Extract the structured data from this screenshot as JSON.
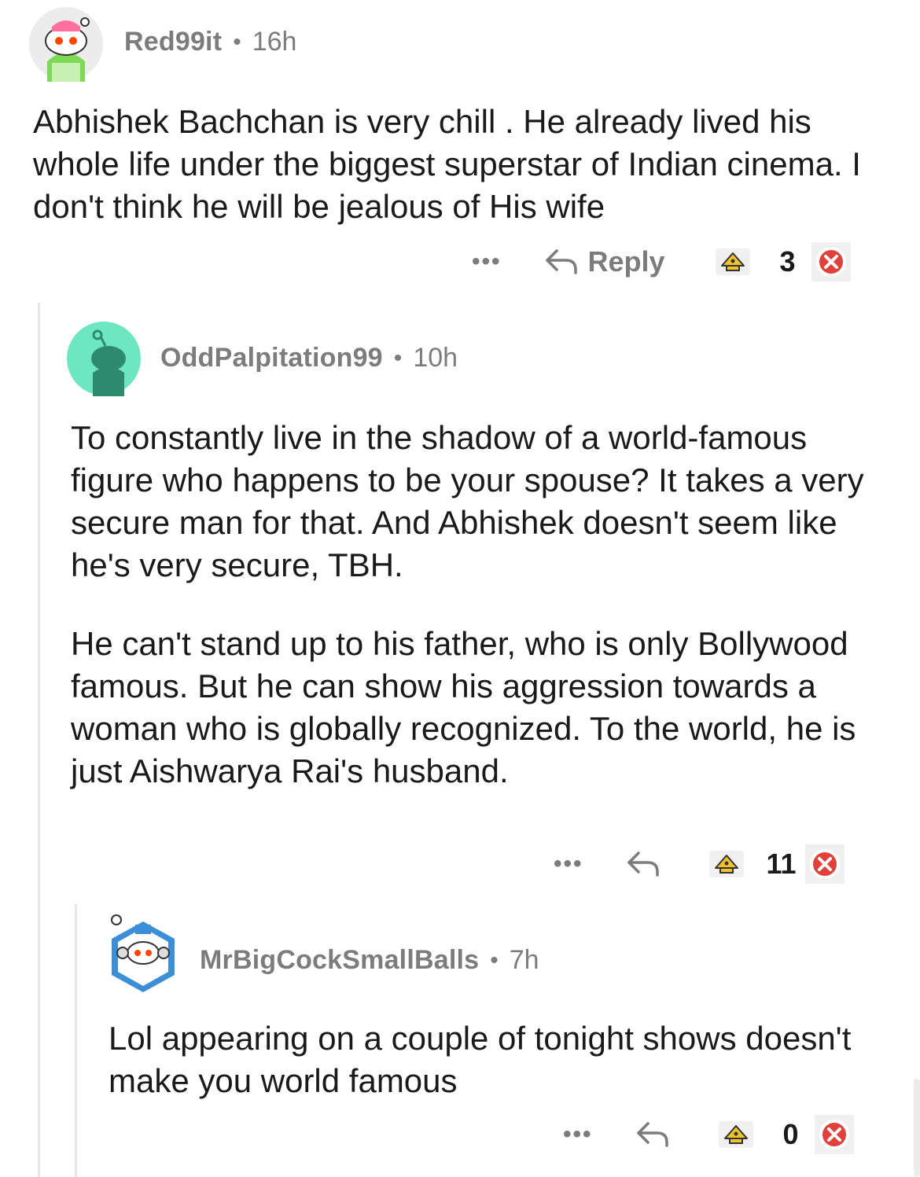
{
  "comments": [
    {
      "username": "Red99it",
      "separator": "•",
      "time": "16h",
      "avatar_icon": "snoo-avatar-icon",
      "paragraphs": [
        "Abhishek Bachchan is very chill . He already lived his whole life under the biggest superstar of Indian cinema. I don't think he will be jealous of His wife"
      ],
      "more_label": "•••",
      "reply_label": "Reply",
      "score": "3"
    },
    {
      "username": "OddPalpitation99",
      "separator": "•",
      "time": "10h",
      "avatar_icon": "snoo-avatar-icon",
      "paragraphs": [
        "To constantly live in the shadow of a world-famous figure who happens to be your spouse? It takes a very secure man for that. And Abhishek doesn't seem like he's very secure, TBH.",
        "He can't stand up to his father, who is only Bollywood famous. But he can show his aggression towards a woman who is globally recognized. To the world, he is just Aishwarya Rai's husband."
      ],
      "more_label": "•••",
      "score": "11"
    },
    {
      "username": "MrBigCockSmallBalls",
      "separator": "•",
      "time": "7h",
      "avatar_icon": "snoo-avatar-icon",
      "paragraphs": [
        "Lol appearing on a couple of tonight shows doesn't make you world famous"
      ],
      "more_label": "•••",
      "score": "0"
    }
  ],
  "colors": {
    "meta_gray": "#7c7c7c",
    "thread_line": "#e6e6e6",
    "downvote_red": "#e0413a",
    "upvote_gold": "#f2c230"
  }
}
